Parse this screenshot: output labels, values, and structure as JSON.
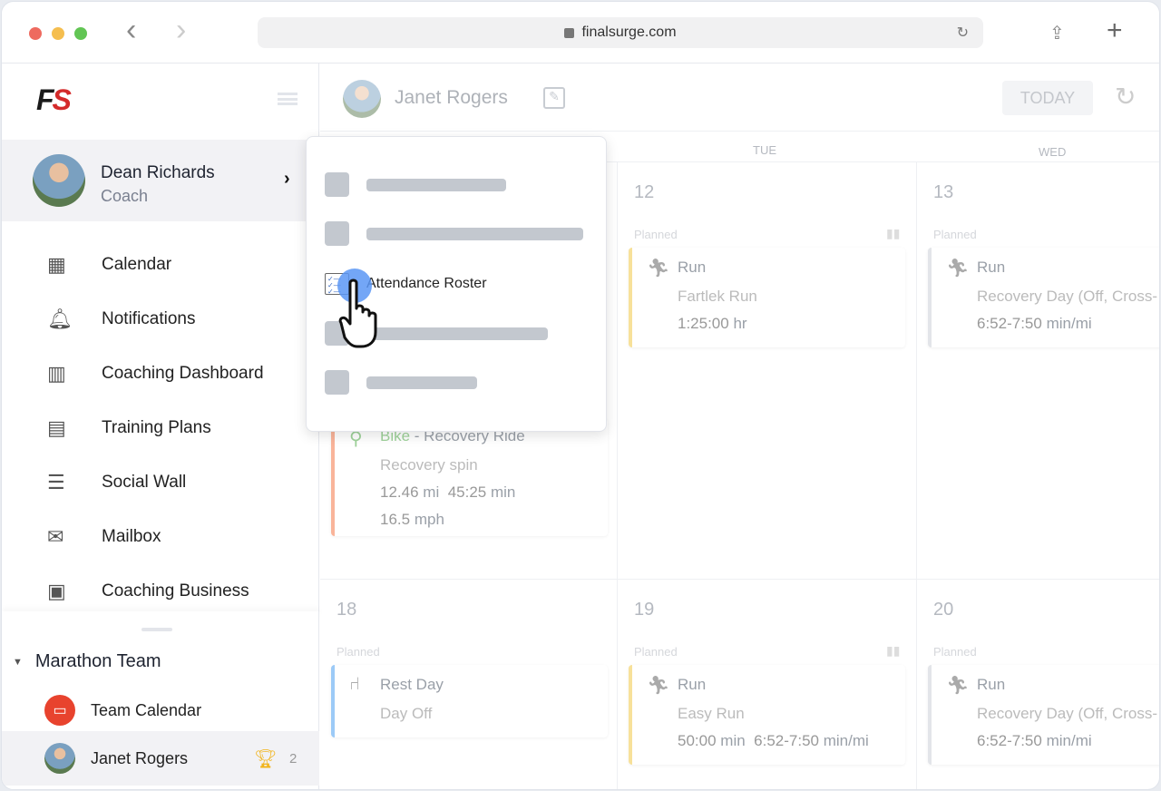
{
  "browser": {
    "url": "finalsurge.com",
    "back": "‹",
    "forward": "›"
  },
  "logo": {
    "f": "F",
    "s": "S"
  },
  "profile": {
    "name": "Dean Richards",
    "role": "Coach"
  },
  "nav": [
    {
      "label": "Calendar",
      "icon": "calendar-icon",
      "glyph": "▦"
    },
    {
      "label": "Notifications",
      "icon": "bell-icon",
      "glyph": "🔔︎"
    },
    {
      "label": "Coaching Dashboard",
      "icon": "bar-chart-icon",
      "glyph": "▥"
    },
    {
      "label": "Training Plans",
      "icon": "clipboard-icon",
      "glyph": "▤"
    },
    {
      "label": "Social Wall",
      "icon": "wall-icon",
      "glyph": "☰"
    },
    {
      "label": "Mailbox",
      "icon": "mail-icon",
      "glyph": "✉"
    },
    {
      "label": "Coaching Business",
      "icon": "briefcase-icon",
      "glyph": "▣"
    }
  ],
  "team": {
    "name": "Marathon Team",
    "calendar": "Team Calendar",
    "member": "Janet Rogers",
    "trophy_count": "2"
  },
  "header": {
    "athlete": "Janet Rogers",
    "today": "TODAY"
  },
  "days": [
    "TUE",
    "WED"
  ],
  "menu": {
    "highlighted": "Attendance Roster"
  },
  "week1": {
    "mon_card": {
      "sport": "Bike",
      "title": " - Recovery Ride",
      "desc": "Recovery spin",
      "dist": "12.46",
      "dist_u": "mi",
      "time": "45:25",
      "time_u": "min",
      "speed": "16.5",
      "speed_u": "mph"
    },
    "tue": {
      "num": "12",
      "planned": "Planned",
      "sport": "Run",
      "desc": "Fartlek Run",
      "val": "1:25:00",
      "unit": "hr"
    },
    "wed": {
      "num": "13",
      "planned": "Planned",
      "sport": "Run",
      "desc": "Recovery Day (Off, Cross-",
      "val": "6:52-7:50",
      "unit": "min/mi"
    }
  },
  "week2": {
    "mon": {
      "num": "18",
      "planned": "Planned",
      "sport": "Rest Day",
      "desc": "Day Off"
    },
    "tue": {
      "num": "19",
      "planned": "Planned",
      "sport": "Run",
      "desc": "Easy Run",
      "val": "50:00",
      "unit": "min",
      "val2": "6:52-7:50",
      "unit2": "min/mi"
    },
    "wed": {
      "num": "20",
      "planned": "Planned",
      "sport": "Run",
      "desc": "Recovery Day (Off, Cross-",
      "val": "6:52-7:50",
      "unit": "min/mi"
    }
  },
  "colors": {
    "run": "#f7e19a",
    "rest": "#9ccaf7",
    "bike": "#f9b49a",
    "gray": "#e3e5e9",
    "logo_red": "#d42a2a",
    "accent": "#6aa6f7"
  }
}
